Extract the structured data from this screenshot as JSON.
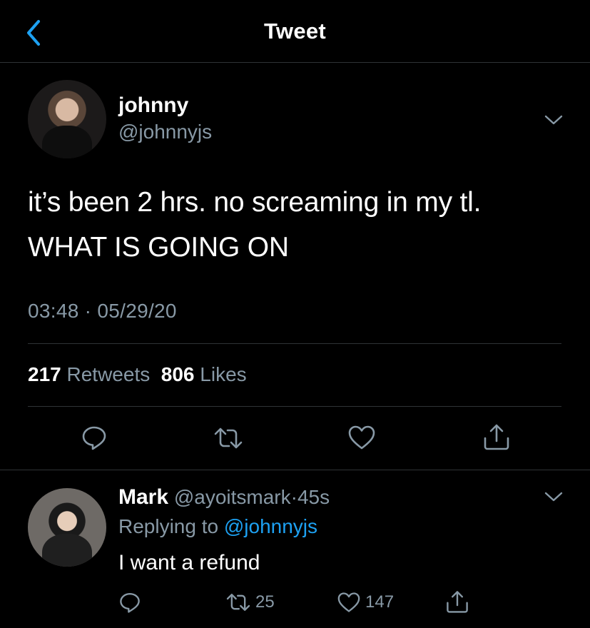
{
  "header": {
    "title": "Tweet",
    "back_icon": "chevron-left-icon",
    "accent": "#1da1f2"
  },
  "tweet": {
    "name": "johnny",
    "handle": "@johnnyjs",
    "text_line1": "it’s been 2 hrs. no screaming in my tl.",
    "text_line2": "WHAT IS GOING ON",
    "time": "03:48",
    "dot": "·",
    "date": "05/29/20",
    "retweets_count": "217",
    "retweets_label": "Retweets",
    "likes_count": "806",
    "likes_label": "Likes",
    "actions": [
      "reply-icon",
      "retweet-icon",
      "like-icon",
      "share-icon"
    ]
  },
  "reply": {
    "name": "Mark",
    "handle": "@ayoitsmark",
    "dot": "·",
    "age": "45s",
    "replying_prefix": "Replying to",
    "replying_to": "@johnnyjs",
    "text": "I want a refund",
    "retweets": "25",
    "likes": "147"
  },
  "colors": {
    "background": "#000000",
    "text": "#ffffff",
    "secondary": "#8899a6",
    "separator": "#2f3336",
    "link": "#1da1f2"
  }
}
